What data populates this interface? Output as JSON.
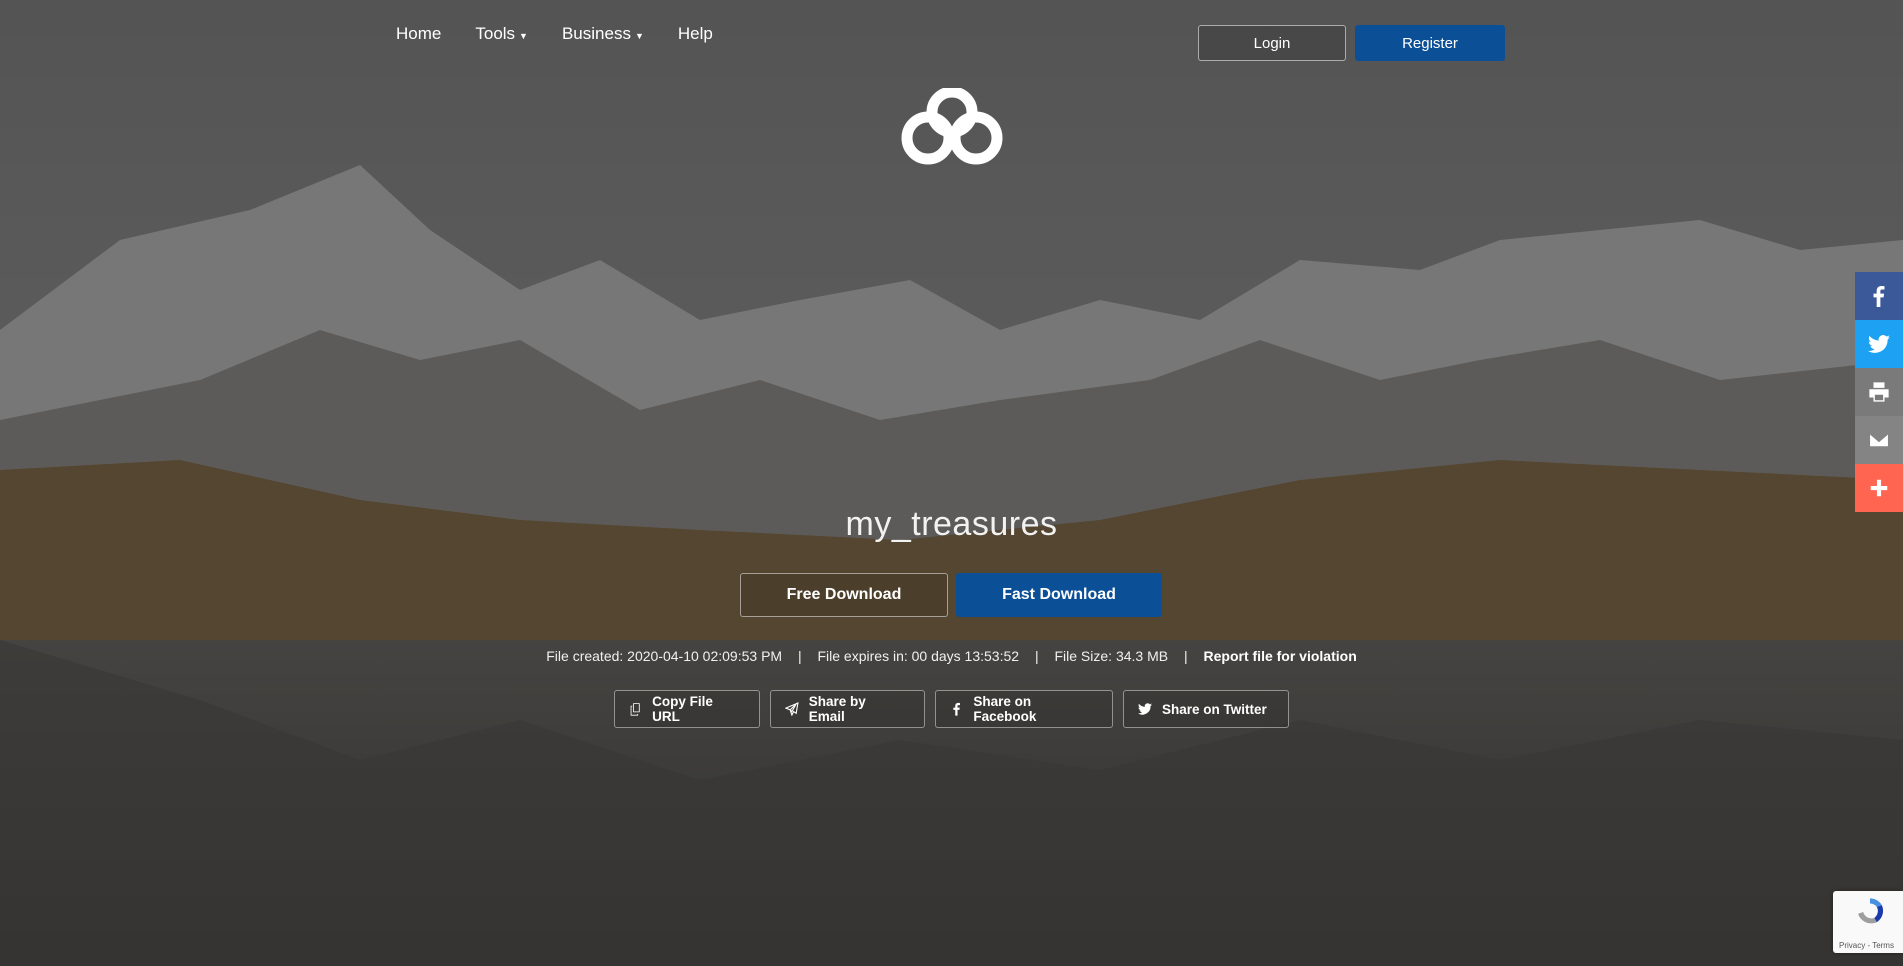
{
  "nav": {
    "items": [
      {
        "label": "Home",
        "has_dropdown": false
      },
      {
        "label": "Tools",
        "has_dropdown": true
      },
      {
        "label": "Business",
        "has_dropdown": true
      },
      {
        "label": "Help",
        "has_dropdown": false
      }
    ],
    "login_label": "Login",
    "register_label": "Register"
  },
  "file": {
    "name": "my_treasures",
    "free_download_label": "Free Download",
    "fast_download_label": "Fast Download",
    "created": "File created: 2020-04-10 02:09:53 PM",
    "expires": "File expires in: 00 days 13:53:52",
    "size": "File Size: 34.3 MB",
    "separator": "|",
    "report_label": "Report file for violation"
  },
  "share": {
    "copy_url_label": "Copy File URL",
    "email_label": "Share by Email",
    "facebook_label": "Share on Facebook",
    "twitter_label": "Share on Twitter"
  },
  "sidebar": [
    {
      "icon": "facebook-icon",
      "color": "#3b5998"
    },
    {
      "icon": "twitter-icon",
      "color": "#1da1f2"
    },
    {
      "icon": "print-icon",
      "color": "#7a7a7a"
    },
    {
      "icon": "email-icon",
      "color": "#848484"
    },
    {
      "icon": "plus-icon",
      "color": "#ff6550"
    }
  ],
  "recaptcha": {
    "text": "Privacy - Terms"
  },
  "colors": {
    "primary_button": "#0b4f96"
  }
}
